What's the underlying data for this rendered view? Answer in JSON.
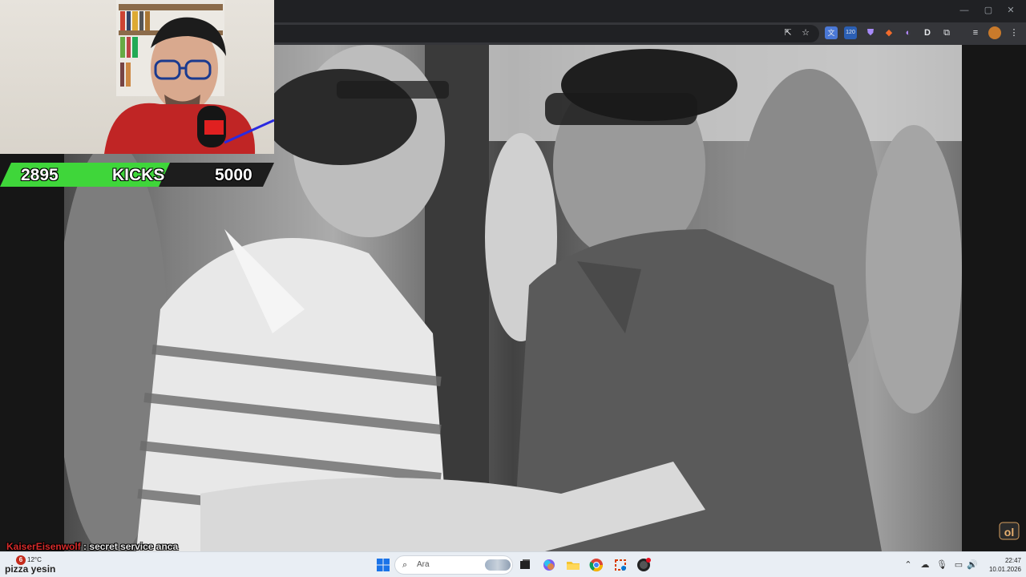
{
  "kicks_bar": {
    "current": "2895",
    "label": "KICKS",
    "goal": "5000",
    "progress": 0.579,
    "accent": "#3fd63a"
  },
  "chat": {
    "user": "KaiserEisenwolf",
    "separator": ":",
    "message": "secret service anca"
  },
  "browser": {
    "toolbar_icons": [
      "share-icon",
      "star-icon",
      "translate-icon",
      "extension-badge-icon",
      "shield-icon",
      "fox-icon",
      "bookmark-icon",
      "d-icon",
      "puzzle-icon",
      "playlist-icon",
      "profile-icon",
      "menu-icon"
    ],
    "badge_count": "120"
  },
  "taskbar": {
    "weather_alert": "6",
    "temperature": "12°C",
    "weather_desc": "pizza yesin",
    "search_placeholder": "Ara",
    "time": "22:47",
    "date": "10.01.2026",
    "apps": [
      "start-icon",
      "task-view-icon",
      "copilot-icon",
      "file-explorer-icon",
      "chrome-icon",
      "snipping-tool-icon",
      "obs-icon"
    ]
  },
  "colors": {
    "chat_user": "#d62b2b",
    "taskbar_bg": "#e9eef4",
    "browser_dark": "#202124"
  }
}
